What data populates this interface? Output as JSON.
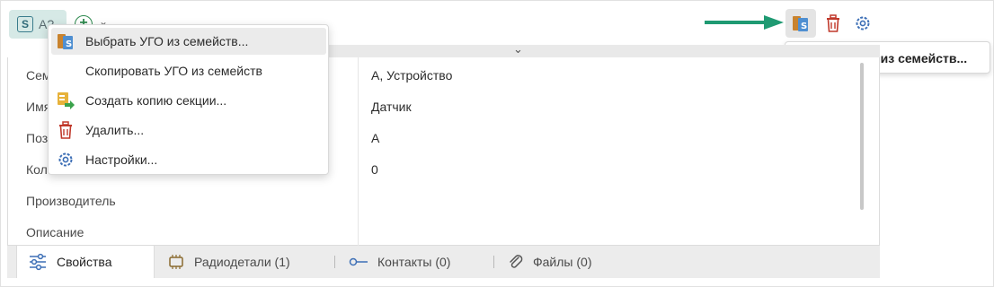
{
  "toolbar": {
    "chip_letter": "S",
    "chip_text": "A?",
    "add_symbol": "+",
    "add_chevron": "⌄",
    "icons": [
      "select-ugo-icon",
      "delete-icon",
      "settings-icon"
    ]
  },
  "tooltip": {
    "text": "Выбрать УГО из семейств..."
  },
  "menu": {
    "items": [
      {
        "label": "Выбрать УГО из семейств...",
        "icon": "select-ugo-icon"
      },
      {
        "label": "Скопировать УГО из семейств",
        "icon": ""
      },
      {
        "label": "Создать копию секции...",
        "icon": "copy-section-icon"
      },
      {
        "label": "Удалить...",
        "icon": "delete-icon"
      },
      {
        "label": "Настройки...",
        "icon": "settings-icon"
      }
    ]
  },
  "properties": {
    "labels": [
      "Сем",
      "Имя",
      "Поз",
      "Кол",
      "Производитель",
      "Описание"
    ],
    "values": [
      "А, Устройство",
      "Датчик",
      "А",
      "0"
    ]
  },
  "tabs": [
    {
      "label": "Свойства",
      "icon": "sliders-icon"
    },
    {
      "label": "Радиодетали (1)",
      "icon": "chip-icon"
    },
    {
      "label": "Контакты (0)",
      "icon": "contact-icon"
    },
    {
      "label": "Файлы (0)",
      "icon": "paperclip-icon"
    }
  ],
  "colors": {
    "accent_teal": "#22a07a",
    "delete_red": "#c0392b",
    "settings_blue": "#3d6fb6",
    "chip_bg": "#d6e9e6"
  }
}
